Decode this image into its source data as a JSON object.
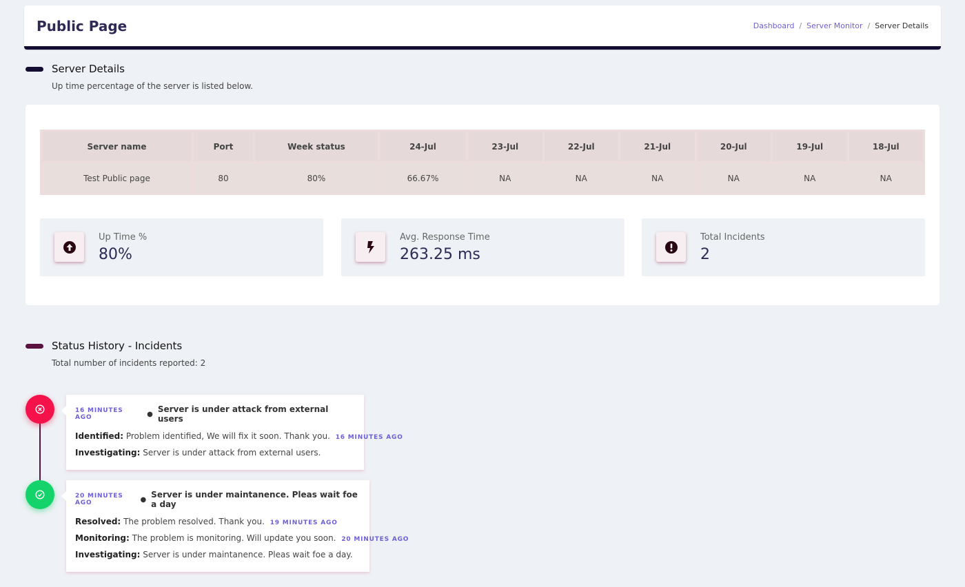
{
  "header": {
    "title": "Public Page",
    "breadcrumb": [
      "Dashboard",
      "Server Monitor",
      "Server Details"
    ],
    "breadcrumb_separator": "/"
  },
  "server_details": {
    "title": "Server Details",
    "subtitle": "Up time percentage of the server is listed below.",
    "bar_color": "#140d33",
    "table": {
      "headers": [
        "Server name",
        "Port",
        "Week status",
        "24-Jul",
        "23-Jul",
        "22-Jul",
        "21-Jul",
        "20-Jul",
        "19-Jul",
        "18-Jul"
      ],
      "rows": [
        [
          "Test Public page",
          "80",
          "80%",
          "66.67%",
          "NA",
          "NA",
          "NA",
          "NA",
          "NA",
          "NA"
        ]
      ]
    },
    "stats": [
      {
        "label": "Up Time %",
        "value": "80%",
        "icon": "arrow-up-circle-icon"
      },
      {
        "label": "Avg. Response Time",
        "value": "263.25 ms",
        "icon": "bolt-icon"
      },
      {
        "label": "Total Incidents",
        "value": "2",
        "icon": "exclamation-circle-icon"
      }
    ]
  },
  "status_history": {
    "title": "Status History - Incidents",
    "subtitle": "Total number of incidents reported: 2",
    "bar_color": "#5a1240",
    "incidents": [
      {
        "status": "red",
        "icon": "x-circle-icon",
        "ago": "16 MINUTES AGO",
        "title": "Server is under attack from external users",
        "updates": [
          {
            "label": "Identified:",
            "text": "Problem identified, We will fix it soon. Thank you.",
            "ago": "16 MINUTES AGO"
          },
          {
            "label": "Investigating:",
            "text": "Server is under attack from external users.",
            "ago": ""
          }
        ]
      },
      {
        "status": "green",
        "icon": "check-circle-icon",
        "ago": "20 MINUTES AGO",
        "title": "Server is under maintanence. Pleas wait foe a day",
        "updates": [
          {
            "label": "Resolved:",
            "text": "The problem resolved. Thank you.",
            "ago": "19 MINUTES AGO"
          },
          {
            "label": "Monitoring:",
            "text": "The problem is monitoring. Will update you soon.",
            "ago": "20 MINUTES AGO"
          },
          {
            "label": "Investigating:",
            "text": "Server is under maintanence. Pleas wait foe a day.",
            "ago": ""
          }
        ]
      }
    ]
  }
}
